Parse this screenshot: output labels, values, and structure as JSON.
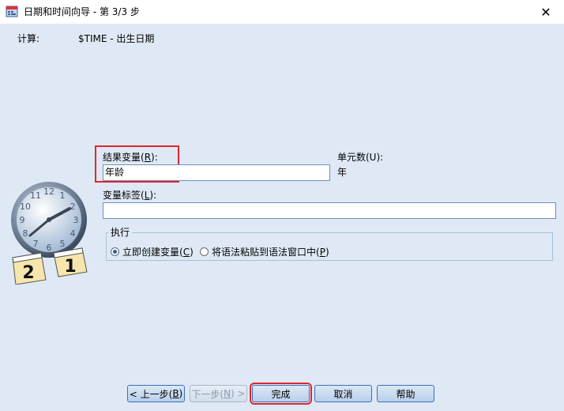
{
  "window": {
    "title": "日期和时间向导 - 第 3/3 步",
    "close_glyph": "✕"
  },
  "compute": {
    "label": "计算:",
    "value": "$TIME - 出生日期"
  },
  "result_variable": {
    "label_prefix": "结果变量(",
    "label_key": "R",
    "label_suffix": "):",
    "value": "年龄"
  },
  "units": {
    "label": "单元数(U):",
    "value": "年"
  },
  "variable_label": {
    "label_prefix": "变量标签(",
    "label_key": "L",
    "label_suffix": "):",
    "value": ""
  },
  "execution": {
    "group_label": "执行",
    "options": [
      {
        "prefix": "立即创建变量(",
        "key": "C",
        "suffix": ")",
        "selected": true
      },
      {
        "prefix": "将语法粘贴到语法窗口中(",
        "key": "P",
        "suffix": ")",
        "selected": false
      }
    ]
  },
  "clock_illustration": {
    "numbers": [
      "12",
      "1",
      "2",
      "3",
      "4",
      "5",
      "6",
      "7",
      "8",
      "9",
      "10",
      "11"
    ],
    "calendar_cards": [
      "2",
      "1"
    ]
  },
  "buttons": {
    "back": {
      "prefix": "< 上一步(",
      "key": "B",
      "suffix": ")"
    },
    "next": {
      "prefix": "下一步(",
      "key": "N",
      "suffix": ") >"
    },
    "finish": "完成",
    "cancel": "取消",
    "help": "帮助"
  },
  "colors": {
    "highlight_red": "#e0262f",
    "dialog_bg": "#dfe9f5",
    "radio_accent": "#1c5fbf"
  }
}
